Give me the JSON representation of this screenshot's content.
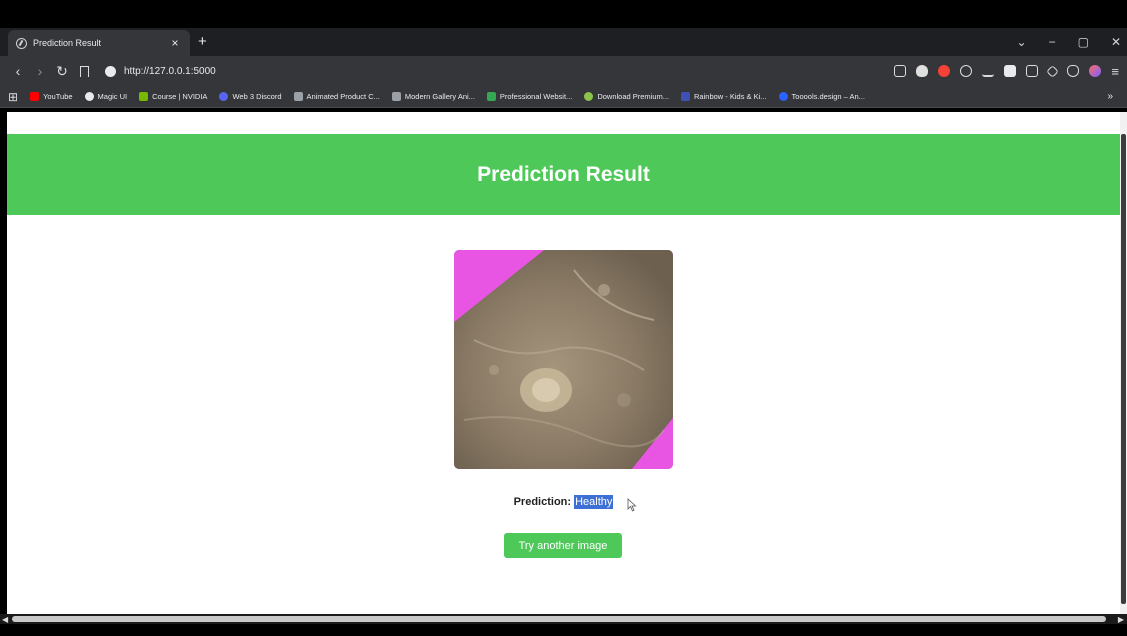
{
  "browser": {
    "tab_title": "Prediction Result",
    "tab_close": "×",
    "new_tab": "+",
    "url": "http://127.0.0.1:5000",
    "window_controls": [
      "⌄",
      "−",
      "▢",
      "✕"
    ],
    "bookmarks_more": "»",
    "bookmarks": [
      {
        "label": "YouTube",
        "color": "#ff0000"
      },
      {
        "label": "Magic UI",
        "color": "#e8eaed"
      },
      {
        "label": "Course | NVIDIA",
        "color": "#76b900"
      },
      {
        "label": "Web 3 Discord",
        "color": "#5865f2"
      },
      {
        "label": "Animated Product C...",
        "color": "#9aa0a6"
      },
      {
        "label": "Modern Gallery Ani...",
        "color": "#9aa0a6"
      },
      {
        "label": "Professional Websit...",
        "color": "#34a853"
      },
      {
        "label": "Download Premium...",
        "color": "#8bc34a"
      },
      {
        "label": "Rainbow - Kids & Ki...",
        "color": "#3f51b5"
      },
      {
        "label": "Tooools.design – An...",
        "color": "#2962ff"
      }
    ]
  },
  "page": {
    "header_title": "Prediction Result",
    "header_color": "#4fc85a",
    "prediction_label": "Prediction:",
    "prediction_value": "Healthy",
    "button_label": "Try another image",
    "image_bg_color": "#e755e2"
  }
}
